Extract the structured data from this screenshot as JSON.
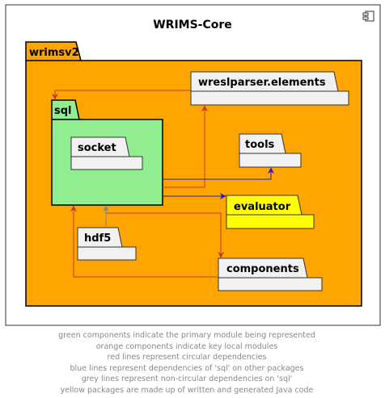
{
  "diagram": {
    "title": "WRIMS-Core",
    "packages": {
      "wrimsv2": "wrimsv2",
      "sql": "sql",
      "socket": "socket",
      "wreslparser": "wreslparser.elements",
      "tools": "tools",
      "evaluator": "evaluator",
      "hdf5": "hdf5",
      "components": "components"
    },
    "colors": {
      "primary": "#90EE90",
      "local": "#FFA500",
      "generated": "#FFFF00",
      "default": "#F1F1F1",
      "circular": "#C0392B",
      "outgoing": "#1F1FCC",
      "incoming": "#7F8C8D"
    },
    "legend": [
      "green components indicate the primary module being represented",
      "orange components indicate key local modules",
      "red lines represent circular dependencies",
      "blue lines represent dependencies of 'sql' on other packages",
      "grey lines represent non-circular dependencies on 'sql'",
      "yellow packages are made up of written and generated Java code"
    ]
  }
}
